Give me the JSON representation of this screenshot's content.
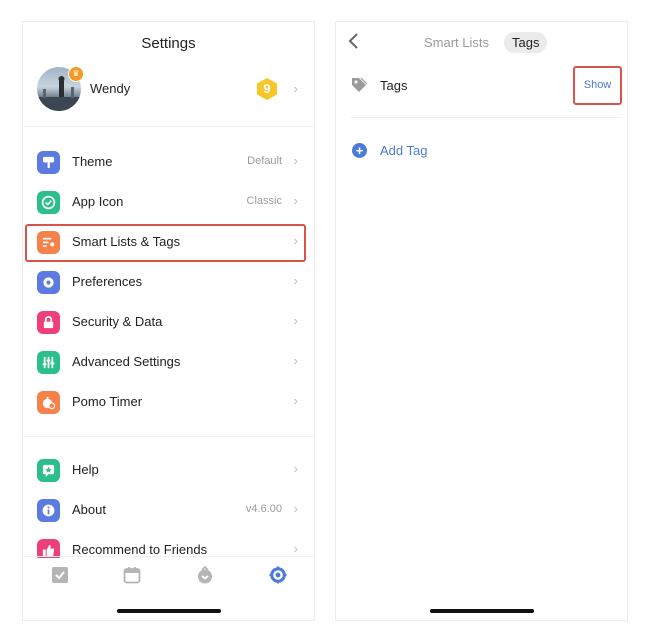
{
  "settings": {
    "title": "Settings",
    "profile": {
      "name": "Wendy",
      "level_badge": "9"
    },
    "items": [
      {
        "label": "Theme",
        "value": "Default",
        "icon": "theme-icon",
        "color": "#5b7be0"
      },
      {
        "label": "App Icon",
        "value": "Classic",
        "icon": "app-icon-check-icon",
        "color": "#2bbf8a"
      },
      {
        "label": "Smart Lists & Tags",
        "value": "",
        "icon": "smart-lists-icon",
        "color": "#f4824a"
      },
      {
        "label": "Preferences",
        "value": "",
        "icon": "gear-icon",
        "color": "#5b7be0"
      },
      {
        "label": "Security & Data",
        "value": "",
        "icon": "lock-icon",
        "color": "#ee3f7c"
      },
      {
        "label": "Advanced Settings",
        "value": "",
        "icon": "sliders-icon",
        "color": "#2bbf8a"
      },
      {
        "label": "Pomo Timer",
        "value": "",
        "icon": "pomo-timer-icon",
        "color": "#f4824a"
      }
    ],
    "items2": [
      {
        "label": "Help",
        "value": "",
        "icon": "help-star-icon",
        "color": "#2bbf8a"
      },
      {
        "label": "About",
        "value": "v4.6.00",
        "icon": "info-icon",
        "color": "#5b7be0"
      },
      {
        "label": "Recommend to Friends",
        "value": "",
        "icon": "thumbs-up-icon",
        "color": "#ee3f7c"
      }
    ],
    "tabbar": [
      "task-check-icon",
      "calendar-icon",
      "pomo-icon",
      "settings-gear-icon"
    ]
  },
  "tags_panel": {
    "segments": {
      "smart_lists": "Smart Lists",
      "tags": "Tags"
    },
    "tags_row": {
      "label": "Tags",
      "action": "Show"
    },
    "add_tag": "Add Tag"
  },
  "colors": {
    "accent": "#4a7bd8",
    "highlight": "#d9534a"
  }
}
